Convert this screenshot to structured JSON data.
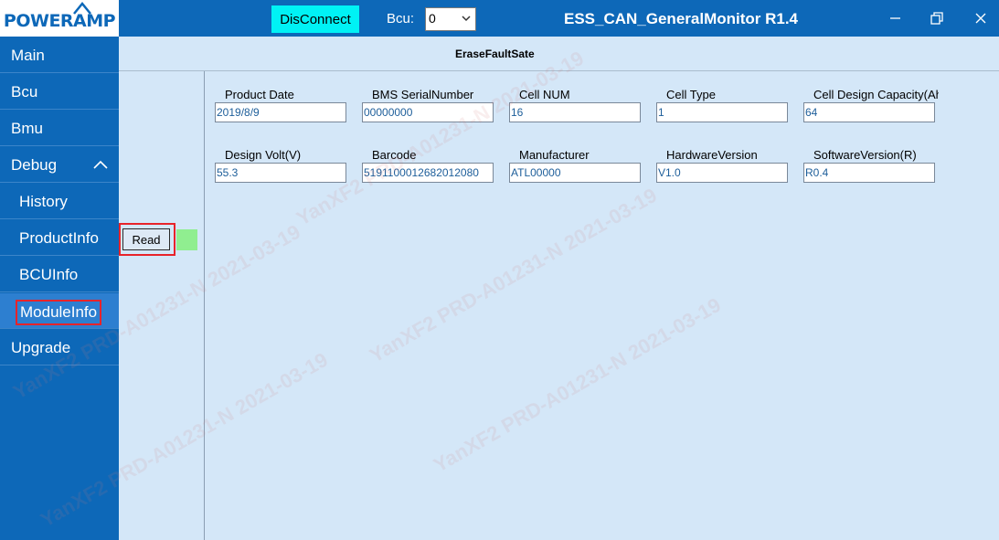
{
  "titlebar": {
    "logo": "POWERAMP",
    "disconnect_label": "DisConnect",
    "bcu_label": "Bcu:",
    "bcu_value": "0",
    "app_title": "ESS_CAN_GeneralMonitor R1.4"
  },
  "sidebar": {
    "items": [
      {
        "label": "Main"
      },
      {
        "label": "Bcu"
      },
      {
        "label": "Bmu"
      },
      {
        "label": "Debug"
      },
      {
        "label": "History"
      },
      {
        "label": "ProductInfo"
      },
      {
        "label": "BCUInfo"
      },
      {
        "label": "ModuleInfo"
      },
      {
        "label": "Upgrade"
      }
    ]
  },
  "subheader": {
    "title": "EraseFaultSate"
  },
  "read_label": "Read",
  "fields": [
    {
      "label": "Product Date",
      "value": "2019/8/9"
    },
    {
      "label": "BMS SerialNumber",
      "value": "00000000"
    },
    {
      "label": "Cell NUM",
      "value": "16"
    },
    {
      "label": "Cell Type",
      "value": "1"
    },
    {
      "label": "Cell Design Capacity(Ah",
      "value": "64"
    },
    {
      "label": "Design Volt(V)",
      "value": "55.3"
    },
    {
      "label": "Barcode",
      "value": "5191100012682012080"
    },
    {
      "label": "Manufacturer",
      "value": "ATL00000"
    },
    {
      "label": "HardwareVersion",
      "value": "V1.0"
    },
    {
      "label": "SoftwareVersion(R)",
      "value": "R0.4"
    }
  ],
  "watermark": "YanXF2  PRD-A01231-N  2021-03-19",
  "colors": {
    "titlebar": "#0d68b8",
    "sidebar": "#0d68b8",
    "sidebar_active": "#2d7fd0",
    "content_bg": "#d4e7f8",
    "disconnect_bg": "#00f2f5",
    "highlight_red": "#e8232a",
    "status_led": "#90ee90",
    "value_text": "#1d5e9a"
  }
}
